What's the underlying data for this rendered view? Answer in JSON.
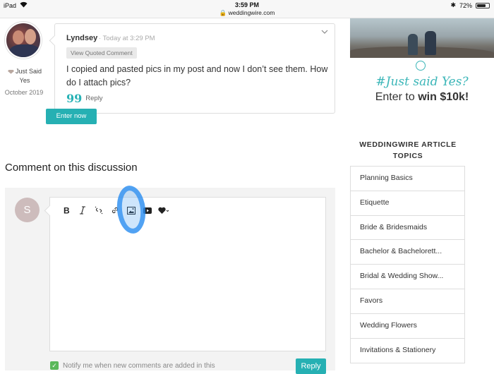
{
  "status_bar": {
    "device": "iPad",
    "time": "3:59 PM",
    "url": "weddingwire.com",
    "battery": "72%",
    "battery_level": 0.72
  },
  "post": {
    "author": "Lyndsey",
    "timestamp": "· Today at 3:29 PM",
    "quoted_button": "View Quoted Comment",
    "body": "I copied and pasted pics in my post and now I don’t see them. How do I attach pics?",
    "reply_label": "Reply",
    "badge_label": "Just Said Yes",
    "joined": "October 2019"
  },
  "composer": {
    "heading": "Comment on this discussion",
    "avatar_initial": "S",
    "notify_label": "Notify me when new comments are added in this",
    "reply_button": "Reply",
    "toolbar": [
      "bold-icon",
      "italic-icon",
      "unlink-icon",
      "link-icon",
      "image-icon",
      "video-icon",
      "heart-icon"
    ]
  },
  "ad": {
    "tagline": "#Just said Yes?",
    "headline_prefix": "Enter to",
    "headline_bold": "win $10k!",
    "cta": "Enter now"
  },
  "topics": {
    "title": "WEDDINGWIRE ARTICLE TOPICS",
    "items": [
      "Planning Basics",
      "Etiquette",
      "Bride & Bridesmaids",
      "Bachelor & Bachelorett...",
      "Bridal & Wedding Show...",
      "Favors",
      "Wedding Flowers",
      "Invitations & Stationery"
    ]
  }
}
